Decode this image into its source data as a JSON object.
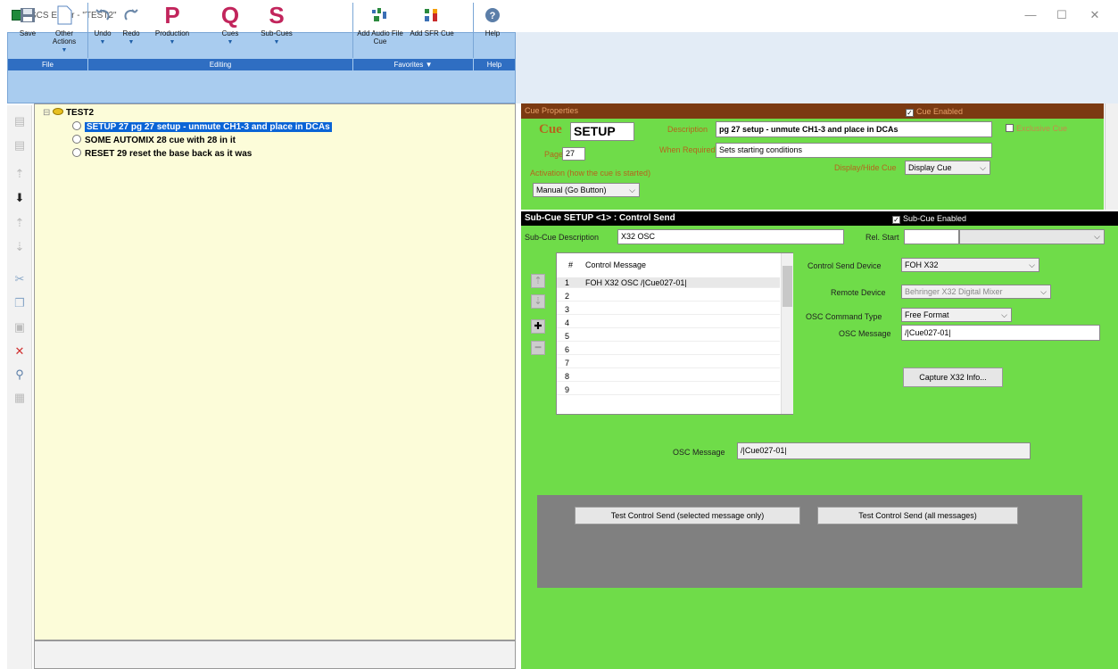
{
  "window": {
    "title": "SCS Editor - \"TEST2\"",
    "min": "—",
    "max": "☐",
    "close": "✕"
  },
  "ribbon": {
    "buttons": [
      {
        "label": "Save",
        "icon": "save-icon"
      },
      {
        "label": "Other Actions",
        "icon": "document-icon"
      },
      {
        "label": "Undo",
        "icon": "undo-icon"
      },
      {
        "label": "Redo",
        "icon": "redo-icon"
      },
      {
        "label": "Production",
        "icon": "P"
      },
      {
        "label": "Cues",
        "icon": "Q"
      },
      {
        "label": "Sub-Cues",
        "icon": "S"
      },
      {
        "label": "Add Audio File Cue",
        "icon": "audio-icon"
      },
      {
        "label": "Add SFR Cue",
        "icon": "sfr-icon"
      },
      {
        "label": "Help",
        "icon": "help-icon"
      }
    ],
    "groups": {
      "file": "File",
      "editing": "Editing",
      "favorites": "Favorites ▼",
      "help": "Help"
    },
    "dropdown": "▼"
  },
  "tree": {
    "root": "TEST2",
    "items": [
      {
        "label": "SETUP 27 pg 27 setup - unmute CH1-3 and place in DCAs",
        "selected": true
      },
      {
        "label": "SOME AUTOMIX 28 cue with 28 in it",
        "selected": false
      },
      {
        "label": "RESET 29 reset the base back as it was",
        "selected": false
      }
    ]
  },
  "cue_properties": {
    "header": "Cue Properties",
    "cue_enabled": "Cue Enabled",
    "cue_label": "Cue",
    "cue_value": "SETUP",
    "description_label": "Description",
    "description_value": "pg 27 setup - unmute CH1-3 and place in DCAs",
    "exclusive_cue": "Exclusive Cue",
    "page_label": "Page",
    "page_value": "27",
    "when_required_label": "When Required",
    "when_required_value": "Sets starting conditions",
    "activation_label": "Activation (how the cue is started)",
    "activation_value": "Manual (Go Button)",
    "display_hide_label": "Display/Hide Cue",
    "display_hide_value": "Display Cue"
  },
  "subcue": {
    "header": "Sub-Cue SETUP <1> : Control Send",
    "enabled": "Sub-Cue Enabled",
    "description_label": "Sub-Cue Description",
    "description_value": "X32 OSC",
    "rel_start_label": "Rel. Start",
    "rel_start_value": "",
    "list_header_num": "#",
    "list_header_msg": "Control Message",
    "rows": [
      {
        "n": "1",
        "msg": "FOH X32 OSC /|Cue027-01|"
      },
      {
        "n": "2",
        "msg": ""
      },
      {
        "n": "3",
        "msg": ""
      },
      {
        "n": "4",
        "msg": ""
      },
      {
        "n": "5",
        "msg": ""
      },
      {
        "n": "6",
        "msg": ""
      },
      {
        "n": "7",
        "msg": ""
      },
      {
        "n": "8",
        "msg": ""
      },
      {
        "n": "9",
        "msg": ""
      }
    ],
    "control_send_device_label": "Control Send Device",
    "control_send_device_value": "FOH X32",
    "remote_device_label": "Remote Device",
    "remote_device_value": "Behringer X32 Digital Mixer",
    "osc_command_type_label": "OSC Command Type",
    "osc_command_type_value": "Free Format",
    "osc_message_label": "OSC Message",
    "osc_message_value": "/|Cue027-01|",
    "capture_button": "Capture X32 Info...",
    "osc_message2_label": "OSC Message",
    "osc_message2_value": "/|Cue027-01|",
    "test_selected": "Test Control Send (selected message only)",
    "test_all": "Test Control Send (all messages)"
  }
}
